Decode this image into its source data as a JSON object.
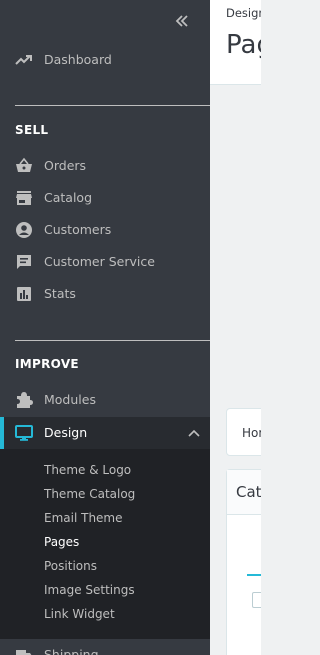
{
  "sidebar": {
    "dashboard": {
      "label": "Dashboard",
      "icon": "trending-up-icon"
    },
    "sections": {
      "sell": "SELL",
      "improve": "IMPROVE"
    },
    "sell_items": [
      {
        "label": "Orders",
        "icon": "basket-icon"
      },
      {
        "label": "Catalog",
        "icon": "store-icon"
      },
      {
        "label": "Customers",
        "icon": "account-circle-icon"
      },
      {
        "label": "Customer Service",
        "icon": "chat-icon"
      },
      {
        "label": "Stats",
        "icon": "bar-chart-icon"
      }
    ],
    "improve_items": [
      {
        "label": "Modules",
        "icon": "puzzle-icon"
      },
      {
        "label": "Design",
        "icon": "desktop-icon",
        "active": true
      }
    ],
    "design_submenu": [
      {
        "label": "Theme & Logo"
      },
      {
        "label": "Theme Catalog"
      },
      {
        "label": "Email Theme"
      },
      {
        "label": "Pages",
        "active": true
      },
      {
        "label": "Positions"
      },
      {
        "label": "Image Settings"
      },
      {
        "label": "Link Widget"
      }
    ],
    "shipping": {
      "label": "Shipping"
    }
  },
  "header": {
    "breadcrumb": "Design",
    "title": "Pages"
  },
  "content": {
    "crumb_home": "Home",
    "card_title": "Categories"
  },
  "colors": {
    "sidebar_bg": "#363a41",
    "accent": "#25b9d7",
    "text_light": "#bebebe"
  }
}
